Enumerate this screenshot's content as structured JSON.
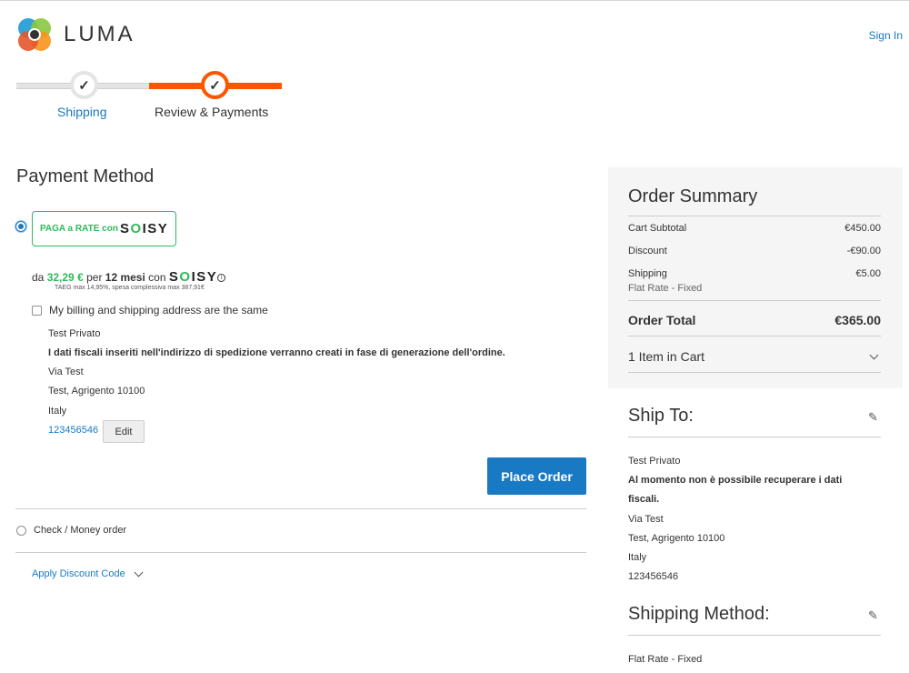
{
  "header": {
    "logo_text": "LUMA",
    "signin": "Sign In"
  },
  "progress": {
    "steps": [
      {
        "label": "Shipping",
        "state": "complete"
      },
      {
        "label": "Review & Payments",
        "state": "current"
      }
    ]
  },
  "payment": {
    "title": "Payment Method",
    "soisy": {
      "badge_prefix": "PAGA a RATE con",
      "brand_s": "S",
      "brand_o": "O",
      "brand_rest": "ISY",
      "installment_prefix": "da",
      "amount": "32,29 €",
      "per": "per",
      "months": "12 mesi",
      "with": "con",
      "taeg": "TAEG max 14,95%, spesa complessiva max 387,91€"
    },
    "billing_same_label": "My billing and shipping address are the same",
    "address": {
      "name": "Test Privato",
      "notice": "I dati fiscali inseriti nell'indirizzo di spedizione verranno creati in fase di generazione dell'ordine.",
      "street": "Via Test",
      "city": "Test, Agrigento 10100",
      "country": "Italy",
      "phone": "123456546"
    },
    "edit_label": "Edit",
    "place_order_label": "Place Order",
    "check_money_label": "Check / Money order",
    "discount_label": "Apply Discount Code"
  },
  "summary": {
    "title": "Order Summary",
    "rows": [
      {
        "label": "Cart Subtotal",
        "value": "€450.00"
      },
      {
        "label": "Discount",
        "value": "-€90.00"
      },
      {
        "label": "Shipping",
        "value": "€5.00"
      }
    ],
    "shipping_sub": "Flat Rate - Fixed",
    "total_label": "Order Total",
    "total_value": "€365.00",
    "items_label": "1 Item in Cart"
  },
  "ship_to": {
    "title": "Ship To:",
    "name": "Test Privato",
    "notice_line1": "Al momento non è possibile recuperare i dati",
    "notice_line2": "fiscali.",
    "street": "Via Test",
    "city": "Test, Agrigento 10100",
    "country": "Italy",
    "phone": "123456546"
  },
  "shipping_method": {
    "title": "Shipping Method:",
    "value": "Flat Rate - Fixed"
  },
  "colors": {
    "accent_blue": "#1979c3",
    "progress_orange": "#ff5501",
    "soisy_green": "#2fba5a"
  }
}
